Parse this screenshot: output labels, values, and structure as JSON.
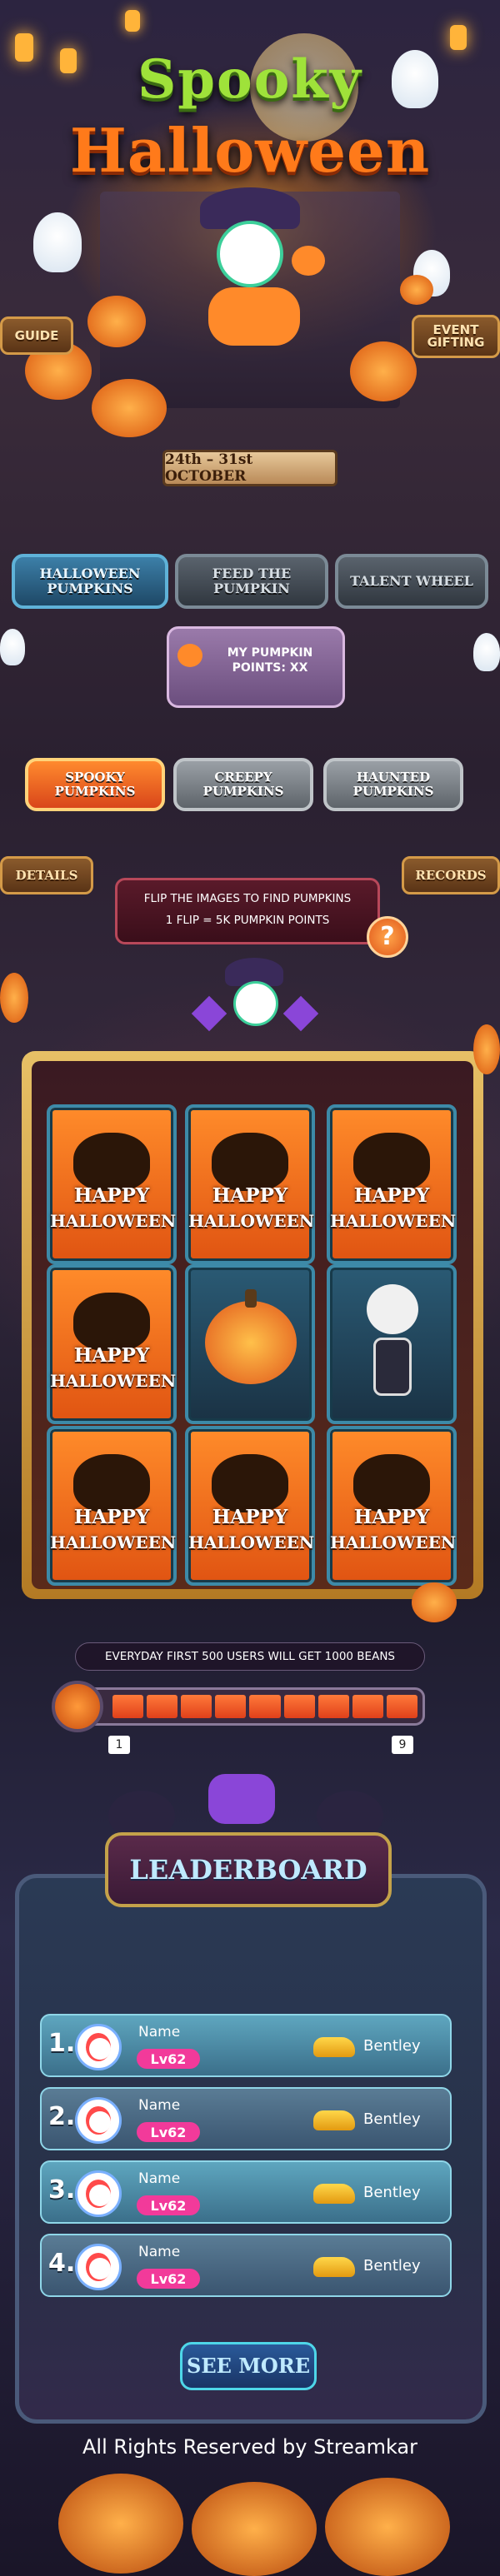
{
  "title": {
    "line1": "Spooky",
    "line2": "Halloween"
  },
  "side_buttons": {
    "guide": "GUIDE",
    "event_gifting": "EVENT GIFTING",
    "details": "DETAILS",
    "records": "RECORDS"
  },
  "date_range": "24th – 31st OCTOBER",
  "main_tabs": [
    "HALLOWEEN PUMPKINS",
    "FEED THE PUMPKIN",
    "TALENT WHEEL"
  ],
  "points": {
    "label": "MY PUMPKIN POINTS: XX"
  },
  "sub_tabs": [
    "SPOOKY PUMPKINS",
    "CREEPY PUMPKINS",
    "HAUNTED PUMPKINS"
  ],
  "instructions": {
    "line1": "FLIP THE IMAGES TO FIND PUMPKINS",
    "line2": "1 FLIP = 5K PUMPKIN POINTS",
    "help": "?"
  },
  "card_text": {
    "top": "HAPPY",
    "bottom": "HALLOWEEN"
  },
  "reward_text": "EVERYDAY FIRST 500 USERS WILL GET 1000 BEANS",
  "progress": {
    "min": "1",
    "max": "9",
    "segments": 9,
    "filled": 9
  },
  "leaderboard": {
    "title": "LEADERBOARD",
    "rows": [
      {
        "rank": "1.",
        "name": "Name",
        "level": "Lv62",
        "car": "Bentley"
      },
      {
        "rank": "2.",
        "name": "Name",
        "level": "Lv62",
        "car": "Bentley"
      },
      {
        "rank": "3.",
        "name": "Name",
        "level": "Lv62",
        "car": "Bentley"
      },
      {
        "rank": "4.",
        "name": "Name",
        "level": "Lv62",
        "car": "Bentley"
      }
    ],
    "see_more": "SEE MORE"
  },
  "footer": "All Rights Reserved by Streamkar",
  "colors": {
    "accent_orange": "#ff7a1a",
    "accent_green": "#9fe23a",
    "tab_active": "#3c7fa8",
    "leaderboard_blue": "#3b6f8a"
  }
}
